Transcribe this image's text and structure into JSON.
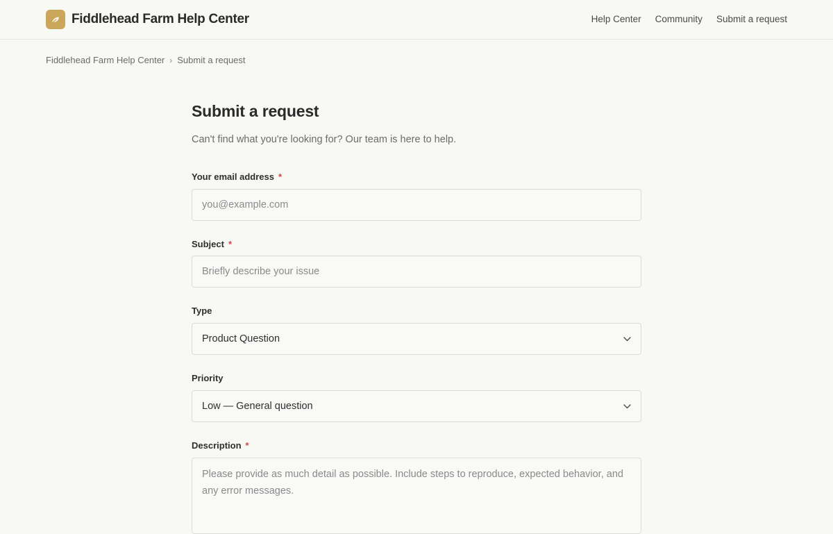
{
  "header": {
    "brand_name": "Fiddlehead Farm Help Center",
    "logo_icon": "leaf-icon",
    "accent_color": "#c9a65a",
    "nav": [
      {
        "label": "Help Center"
      },
      {
        "label": "Community"
      },
      {
        "label": "Submit a request"
      }
    ]
  },
  "breadcrumb": {
    "items": [
      {
        "label": "Fiddlehead Farm Help Center"
      },
      {
        "label": "Submit a request"
      }
    ],
    "separator": "›"
  },
  "page": {
    "title": "Submit a request",
    "subtitle": "Can't find what you're looking for? Our team is here to help."
  },
  "form": {
    "required_marker": "*",
    "email": {
      "label": "Your email address",
      "placeholder": "you@example.com",
      "value": ""
    },
    "subject": {
      "label": "Subject",
      "placeholder": "Briefly describe your issue",
      "value": ""
    },
    "type": {
      "label": "Type",
      "selected": "Product Question"
    },
    "priority": {
      "label": "Priority",
      "selected": "Low — General question"
    },
    "description": {
      "label": "Description",
      "placeholder": "Please provide as much detail as possible. Include steps to reproduce, expected behavior, and any error messages.",
      "value": ""
    }
  }
}
